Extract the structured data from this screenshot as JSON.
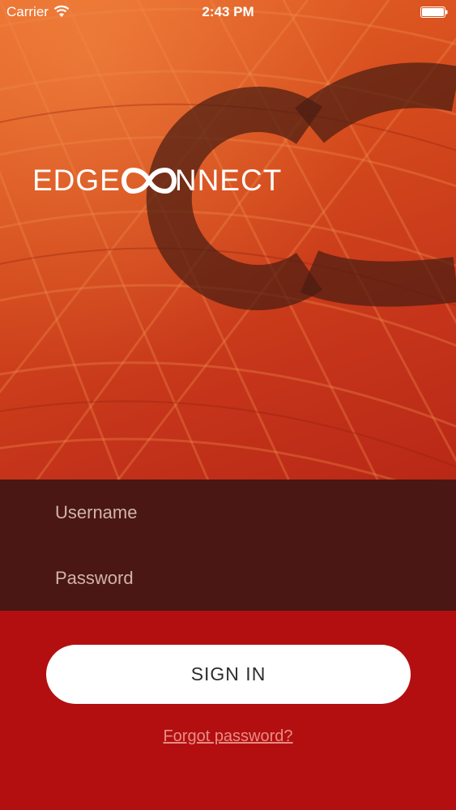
{
  "status_bar": {
    "carrier": "Carrier",
    "time": "2:43 PM"
  },
  "brand": {
    "prefix": "EDGE",
    "suffix": "NNECT"
  },
  "login": {
    "username_placeholder": "Username",
    "password_placeholder": "Password",
    "signin_label": "SIGN IN",
    "forgot_label": "Forgot password?"
  },
  "colors": {
    "hero_orange": "#d44a1c",
    "fields_background": "#4a1714",
    "bottom_red": "#b30f10",
    "button_white": "#ffffff",
    "link_pink": "#e88d86"
  },
  "icons": {
    "wifi": "wifi-icon",
    "battery": "battery-icon",
    "infinity": "infinity-icon"
  }
}
